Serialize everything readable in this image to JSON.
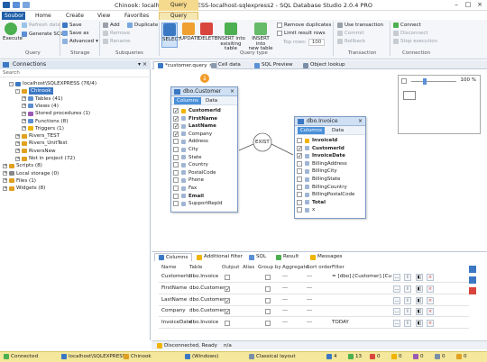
{
  "app": {
    "title": "Chinook: localhost\\SQLEXPRESS-localhost-sqlexpress2 - SQL Database Studio 2.0.4 PRO",
    "context_label": "Query designer"
  },
  "menu": [
    "Soubor",
    "Home",
    "Create",
    "View",
    "Favorites",
    "Query designer"
  ],
  "ribbon": {
    "groups": {
      "query": "Query",
      "storage": "Storage",
      "subqueries": "Subqueries",
      "query_type": "Query type",
      "transaction": "Transaction",
      "connection": "Connection"
    },
    "execute": "Execute",
    "refresh_data": "Refresh data",
    "generate_sql": "Generate SQL",
    "save": "Save",
    "save_as": "Save as",
    "advanced": "Advanced",
    "add": "Add",
    "remove": "Remove",
    "rename": "Rename",
    "duplicate": "Duplicate",
    "select": "SELECT",
    "update": "UPDATE",
    "delete": "DELETE",
    "insert_existing": [
      "INSERT into",
      "exisiting table"
    ],
    "insert_new": [
      "INSERT into",
      "new table"
    ],
    "remove_duplicates": "Remove duplicates",
    "limit_rows": "Limit result rows",
    "top_rows": "Top rows:",
    "top_rows_value": "100",
    "use_transaction": "Use transaction",
    "commit": "Commit",
    "rollback": "Rollback",
    "connect": "Connect",
    "disconnect": "Disconnect",
    "stop_execution": "Stop execution"
  },
  "left_panel": {
    "title": "Connections",
    "search": "Search",
    "tree": [
      {
        "label": "localhost\\SQLEXPRESS (76/4)",
        "depth": 1,
        "expander": "-",
        "color": "#3b78c4"
      },
      {
        "label": "Chinook",
        "depth": 2,
        "expander": "-",
        "color": "#e0a020",
        "selected": true
      },
      {
        "label": "Tables (41)",
        "depth": 3,
        "expander": "+",
        "color": "#5d8fd0"
      },
      {
        "label": "Views (4)",
        "depth": 3,
        "expander": "+",
        "color": "#5d8fd0"
      },
      {
        "label": "Stored procedures (1)",
        "depth": 3,
        "expander": "+",
        "color": "#9b59b6"
      },
      {
        "label": "Functions (8)",
        "depth": 3,
        "expander": "+",
        "color": "#5d8fd0"
      },
      {
        "label": "Triggers (1)",
        "depth": 3,
        "expander": "+",
        "color": "#f0b400"
      },
      {
        "label": "Rivers_TEST",
        "depth": 2,
        "expander": "+",
        "color": "#e0a020"
      },
      {
        "label": "Rivers_UnitTest",
        "depth": 2,
        "expander": "+",
        "color": "#e0a020"
      },
      {
        "label": "RiversNew",
        "depth": 2,
        "expander": "+",
        "color": "#e0a020"
      },
      {
        "label": "Not in project (72)",
        "depth": 2,
        "expander": "+",
        "color": "#e0a020"
      },
      {
        "label": "Scripts (8)",
        "depth": 0,
        "expander": "+",
        "color": "#e0a020"
      },
      {
        "label": "Local storage (0)",
        "depth": 0,
        "expander": "+",
        "color": "#888888"
      },
      {
        "label": "Files (1)",
        "depth": 0,
        "expander": "+",
        "color": "#e0a020"
      },
      {
        "label": "Widgets (8)",
        "depth": 0,
        "expander": "+",
        "color": "#e0a020"
      }
    ]
  },
  "doc_tabs": [
    "*customer.query",
    "Cell data",
    "SQL Preview",
    "Object lookup"
  ],
  "designer": {
    "customer": {
      "title": "dbo.Customer",
      "tab_columns": "Columns",
      "tab_data": "Data",
      "fields": [
        {
          "name": "CustomerId",
          "checked": true,
          "bold": true,
          "key": true
        },
        {
          "name": "FirstName",
          "checked": true,
          "bold": true
        },
        {
          "name": "LastName",
          "checked": true,
          "bold": true
        },
        {
          "name": "Company",
          "checked": true
        },
        {
          "name": "Address",
          "checked": false
        },
        {
          "name": "City",
          "checked": false
        },
        {
          "name": "State",
          "checked": false
        },
        {
          "name": "Country",
          "checked": false
        },
        {
          "name": "PostalCode",
          "checked": false
        },
        {
          "name": "Phone",
          "checked": false
        },
        {
          "name": "Fax",
          "checked": false
        },
        {
          "name": "Email",
          "checked": false,
          "bold": true
        },
        {
          "name": "SupportRepId",
          "checked": false
        }
      ]
    },
    "join": "EXIST",
    "invoice": {
      "title": "dbo.Invoice",
      "tab_columns": "Columns",
      "tab_data": "Data",
      "fields": [
        {
          "name": "InvoiceId",
          "checked": false,
          "bold": true,
          "key": true
        },
        {
          "name": "CustomerId",
          "checked": true,
          "bold": true
        },
        {
          "name": "InvoiceDate",
          "checked": true,
          "bold": true
        },
        {
          "name": "BillingAddress",
          "checked": false
        },
        {
          "name": "BillingCity",
          "checked": false
        },
        {
          "name": "BillingState",
          "checked": false
        },
        {
          "name": "BillingCountry",
          "checked": false
        },
        {
          "name": "BillingPostalCode",
          "checked": false
        },
        {
          "name": "Total",
          "checked": false,
          "bold": true
        },
        {
          "name": "x",
          "checked": false
        }
      ]
    },
    "zoom": "100 %"
  },
  "bottom_tabs": [
    "Columns",
    "Additional filter",
    "SQL",
    "Result",
    "Messages"
  ],
  "grid": {
    "headers": [
      "Name",
      "Table",
      "Output",
      "Alias",
      "Group by",
      "Aggregate",
      "Sort order",
      "Filter"
    ],
    "rows": [
      {
        "name": "CustomerId",
        "table": "dbo.Invoice",
        "output": false,
        "alias": "",
        "group_by": false,
        "aggregate": "---",
        "sort": "---",
        "filter": "= [dbo].[Customer].[Cu"
      },
      {
        "name": "FirstName",
        "table": "dbo.Customer",
        "output": true,
        "alias": "",
        "group_by": false,
        "aggregate": "---",
        "sort": "---",
        "filter": ""
      },
      {
        "name": "LastName",
        "table": "dbo.Customer",
        "output": true,
        "alias": "",
        "group_by": false,
        "aggregate": "---",
        "sort": "---",
        "filter": ""
      },
      {
        "name": "Company",
        "table": "dbo.Customer",
        "output": true,
        "alias": "",
        "group_by": false,
        "aggregate": "---",
        "sort": "---",
        "filter": ""
      },
      {
        "name": "InvoiceDate",
        "table": "dbo.Invoice",
        "output": false,
        "alias": "",
        "group_by": false,
        "aggregate": "---",
        "sort": "---",
        "filter": "TODAY"
      }
    ]
  },
  "status_inner": {
    "state": "Disconnected, Ready",
    "na": "n/a"
  },
  "statusbar": {
    "connected": "Connected",
    "server": "localhost\\SQLEXPRESS",
    "db": "Chinook",
    "windows": "(Windows)",
    "layout": "Classical layout",
    "counters": [
      "4",
      "13",
      "0",
      "0",
      "0",
      "0",
      "0"
    ]
  },
  "colors": {
    "accent": "#1e5fa8",
    "context": "#f5d98c",
    "statusbar": "#f5e79b"
  }
}
